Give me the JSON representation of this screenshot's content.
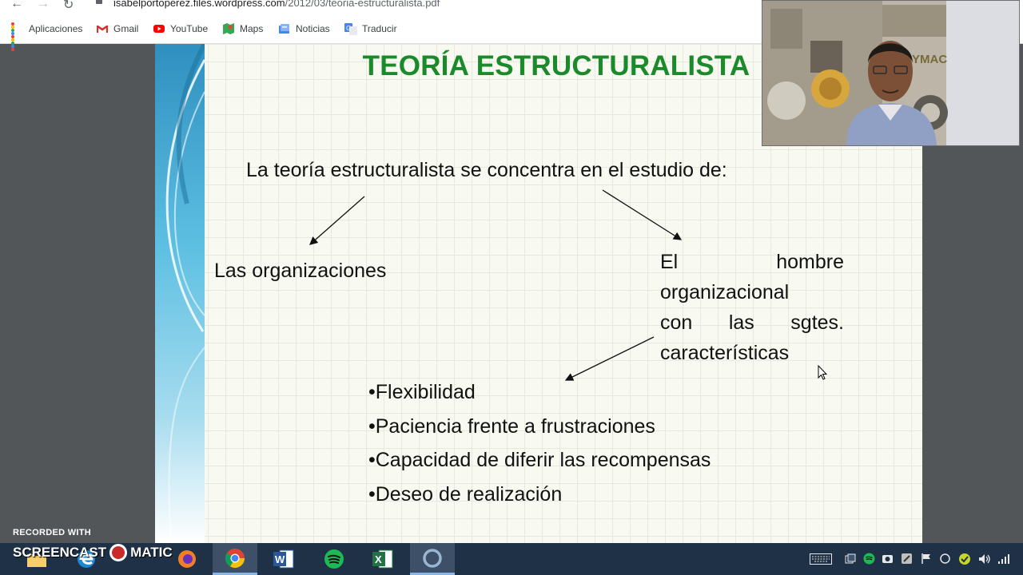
{
  "browser": {
    "url_host": "isabelportoperez.files.wordpress.com",
    "url_path": "/2012/03/teoria-estructuralista.pdf",
    "bookmarks": [
      "Aplicaciones",
      "Gmail",
      "YouTube",
      "Maps",
      "Noticias",
      "Traducir"
    ]
  },
  "slide": {
    "title": "TEORÍA ESTRUCTURALISTA",
    "intro": "La teoría estructuralista se concentra en el estudio de:",
    "left_item": "Las organizaciones",
    "right_item_lines": [
      "El hombre",
      "organizacional",
      "con las sgtes.",
      "características"
    ],
    "bullets": [
      "•Flexibilidad",
      "•Paciencia frente a frustraciones",
      "•Capacidad de diferir las recompensas",
      "•Deseo de realización"
    ],
    "title_color": "#1a8a2a"
  },
  "watermark": {
    "recorded_with": "RECORDED WITH",
    "brand_left": "SCREENCAST",
    "brand_right": "MATIC"
  },
  "taskbar": {
    "apps": [
      "file-explorer",
      "edge",
      "firefox",
      "chrome",
      "word",
      "spotify",
      "excel",
      "cortana"
    ],
    "active_app": "chrome"
  }
}
